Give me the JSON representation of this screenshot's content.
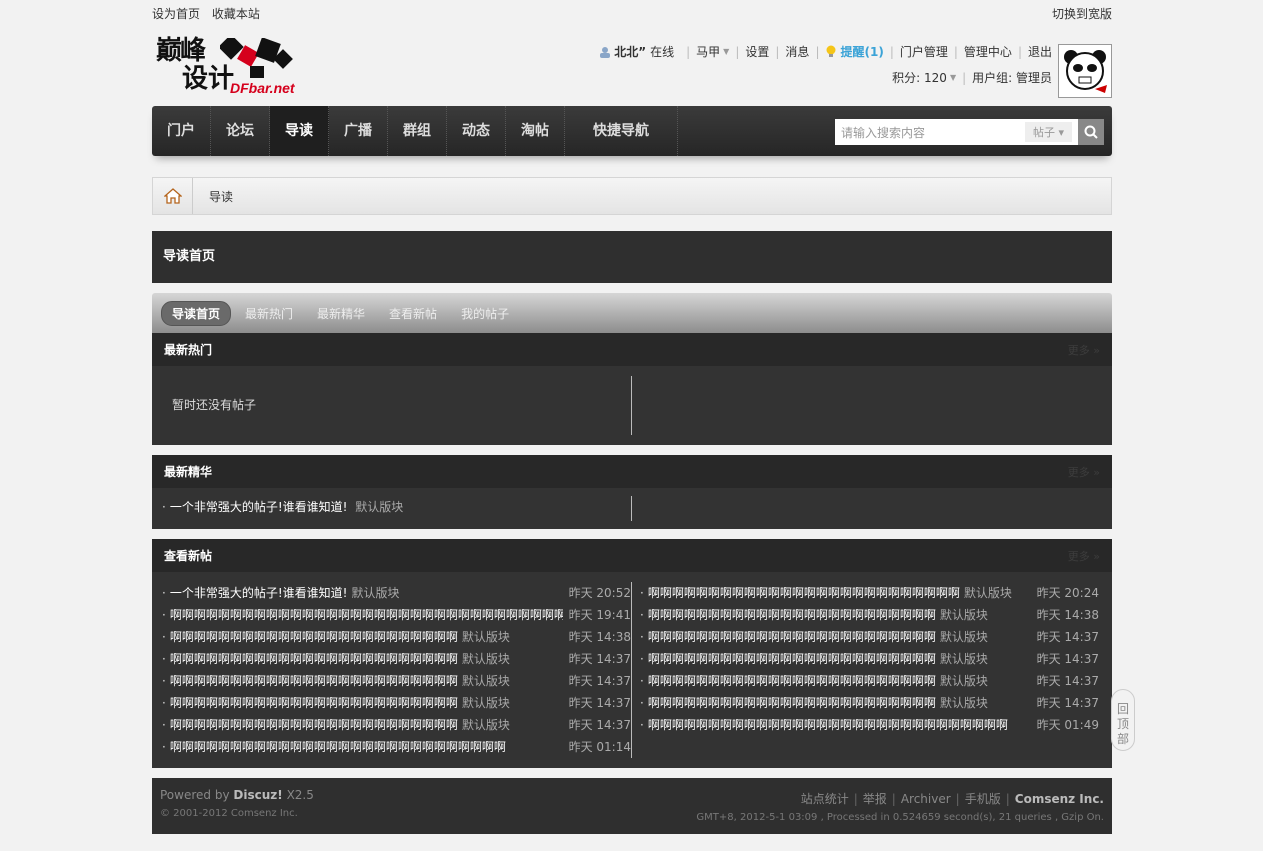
{
  "topbar": {
    "set_home": "设为首页",
    "bookmark": "收藏本站",
    "switch_wide": "切换到宽版"
  },
  "logo": {
    "chars_top": "巅峰",
    "chars_bottom": "设计",
    "brand": "DFbar.net"
  },
  "userbar": {
    "username": "北北”",
    "online": "在线",
    "vest": "马甲",
    "settings": "设置",
    "messages": "消息",
    "remind": "提醒(1)",
    "portal_manage": "门户管理",
    "admin_center": "管理中心",
    "logout": "退出",
    "credits": "积分: 120",
    "usergroup": "用户组: 管理员"
  },
  "nav": {
    "items": [
      "门户",
      "论坛",
      "导读",
      "广播",
      "群组",
      "动态",
      "淘帖"
    ],
    "quick": "快捷导航",
    "active_index": 2,
    "search_placeholder": "请输入搜索内容",
    "search_category": "帖子"
  },
  "breadcrumb": {
    "current": "导读"
  },
  "page_title": "导读首页",
  "tabs": [
    "导读首页",
    "最新热门",
    "最新精华",
    "查看新帖",
    "我的帖子"
  ],
  "sections": {
    "hot": {
      "title": "最新热门",
      "more": "更多 »",
      "empty": "暂时还没有帖子"
    },
    "digest": {
      "title": "最新精华",
      "more": "更多 »",
      "post_title": "一个非常强大的帖子!谁看谁知道!",
      "post_forum": "默认版块"
    },
    "new": {
      "title": "查看新帖",
      "more": "更多 »",
      "left": [
        {
          "title": "一个非常强大的帖子!谁看谁知道!",
          "forum": "默认版块",
          "time": "昨天 20:52"
        },
        {
          "title": "啊啊啊啊啊啊啊啊啊啊啊啊啊啊啊啊啊啊啊啊啊啊啊啊啊啊啊啊啊啊啊啊啊",
          "forum": "",
          "time": "昨天 19:41"
        },
        {
          "title": "啊啊啊啊啊啊啊啊啊啊啊啊啊啊啊啊啊啊啊啊啊啊啊啊",
          "forum": "默认版块",
          "time": "昨天 14:38"
        },
        {
          "title": "啊啊啊啊啊啊啊啊啊啊啊啊啊啊啊啊啊啊啊啊啊啊啊啊",
          "forum": "默认版块",
          "time": "昨天 14:37"
        },
        {
          "title": "啊啊啊啊啊啊啊啊啊啊啊啊啊啊啊啊啊啊啊啊啊啊啊啊",
          "forum": "默认版块",
          "time": "昨天 14:37"
        },
        {
          "title": "啊啊啊啊啊啊啊啊啊啊啊啊啊啊啊啊啊啊啊啊啊啊啊啊",
          "forum": "默认版块",
          "time": "昨天 14:37"
        },
        {
          "title": "啊啊啊啊啊啊啊啊啊啊啊啊啊啊啊啊啊啊啊啊啊啊啊啊",
          "forum": "默认版块",
          "time": "昨天 14:37"
        },
        {
          "title": "啊啊啊啊啊啊啊啊啊啊啊啊啊啊啊啊啊啊啊啊啊啊啊啊啊啊啊啊",
          "forum": "",
          "time": "昨天 01:14"
        }
      ],
      "right": [
        {
          "title": "啊啊啊啊啊啊啊啊啊啊啊啊啊啊啊啊啊啊啊啊啊啊啊啊啊啊",
          "forum": "默认版块",
          "time": "昨天 20:24"
        },
        {
          "title": "啊啊啊啊啊啊啊啊啊啊啊啊啊啊啊啊啊啊啊啊啊啊啊啊",
          "forum": "默认版块",
          "time": "昨天 14:38"
        },
        {
          "title": "啊啊啊啊啊啊啊啊啊啊啊啊啊啊啊啊啊啊啊啊啊啊啊啊",
          "forum": "默认版块",
          "time": "昨天 14:37"
        },
        {
          "title": "啊啊啊啊啊啊啊啊啊啊啊啊啊啊啊啊啊啊啊啊啊啊啊啊",
          "forum": "默认版块",
          "time": "昨天 14:37"
        },
        {
          "title": "啊啊啊啊啊啊啊啊啊啊啊啊啊啊啊啊啊啊啊啊啊啊啊啊",
          "forum": "默认版块",
          "time": "昨天 14:37"
        },
        {
          "title": "啊啊啊啊啊啊啊啊啊啊啊啊啊啊啊啊啊啊啊啊啊啊啊啊",
          "forum": "默认版块",
          "time": "昨天 14:37"
        },
        {
          "title": "啊啊啊啊啊啊啊啊啊啊啊啊啊啊啊啊啊啊啊啊啊啊啊啊啊啊啊啊啊啊",
          "forum": "",
          "time": "昨天 01:49"
        }
      ]
    }
  },
  "footer": {
    "powered_prefix": "Powered by",
    "powered_brand": "Discuz!",
    "powered_version": "X2.5",
    "copyright": "© 2001-2012 Comsenz Inc.",
    "links": [
      "站点统计",
      "举报",
      "Archiver",
      "手机版"
    ],
    "company": "Comsenz Inc.",
    "stats": "GMT+8, 2012-5-1 03:09 , Processed in 0.524659 second(s), 21 queries , Gzip On."
  },
  "totop": "回顶部",
  "colors": {
    "nav_bg": "#2f2f2f",
    "remind": "#3ba3d7",
    "brand_red": "#d5001c"
  }
}
